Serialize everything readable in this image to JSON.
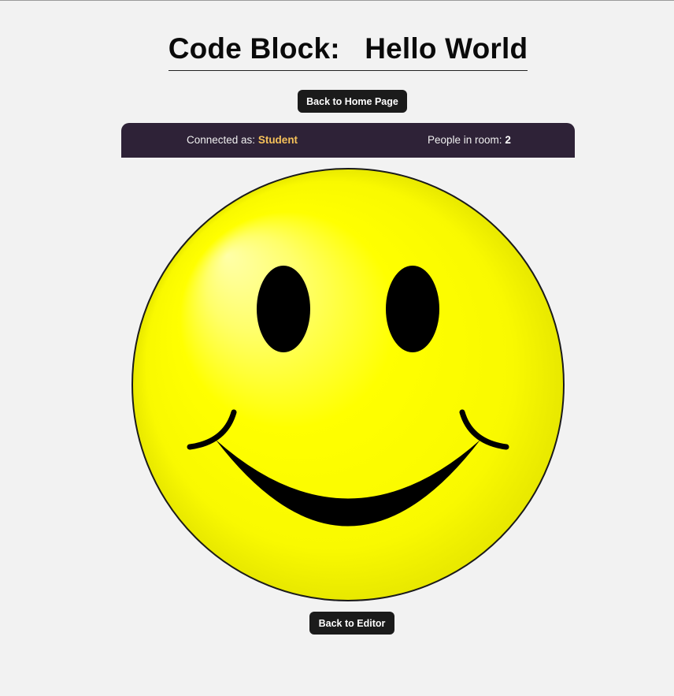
{
  "header": {
    "title": "Code Block:   Hello World"
  },
  "nav": {
    "back_home_label": "Back to Home Page",
    "back_editor_label": "Back to Editor"
  },
  "status": {
    "connected_prefix": "Connected as: ",
    "role": "Student",
    "people_prefix": "People in room: ",
    "people_count": "2"
  },
  "image": {
    "icon": "smiley-face-icon",
    "face_color": "#ffff00",
    "feature_color": "#000000"
  },
  "colors": {
    "background": "#f2f2f2",
    "button": "#1b1b1b",
    "status_bar": "#2e2237",
    "role_accent": "#f5c15a"
  }
}
